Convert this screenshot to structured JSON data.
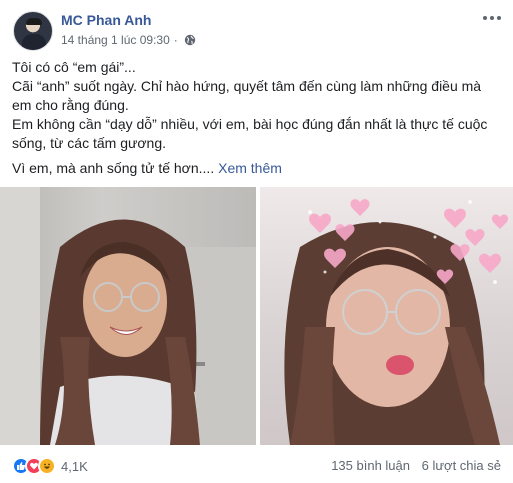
{
  "post": {
    "author": "MC Phan Anh",
    "timestamp": "14 tháng 1 lúc 09:30",
    "separator": "·",
    "privacy_icon": "globe-icon",
    "more_icon": "more-options-icon",
    "lines": [
      "Tôi có cô “em gái”...",
      "Cãi “anh” suốt ngày. Chỉ hào hứng, quyết tâm đến cùng làm những điều mà",
      "em cho rằng đúng.",
      "Em không cần “dạy dỗ” nhiều, với em, bài học đúng đắn nhất là thực tế cuộc",
      "sống, từ các tấm gương."
    ],
    "last_line": "Vì em, mà anh sống tử tế hơn....",
    "see_more": "Xem thêm"
  },
  "photos": [
    {
      "name": "photo-girl-smiling-glasses"
    },
    {
      "name": "photo-girl-hearts-filter"
    }
  ],
  "footer": {
    "reaction_icons": [
      "like-icon",
      "love-icon",
      "haha-icon"
    ],
    "reaction_count": "4,1K",
    "comments": "135 bình luận",
    "shares": "6 lượt chia sẻ"
  },
  "colors": {
    "link": "#385898",
    "secondary_text": "#616770",
    "like": "#1877f2",
    "love": "#f33e58",
    "haha": "#f7b125"
  }
}
